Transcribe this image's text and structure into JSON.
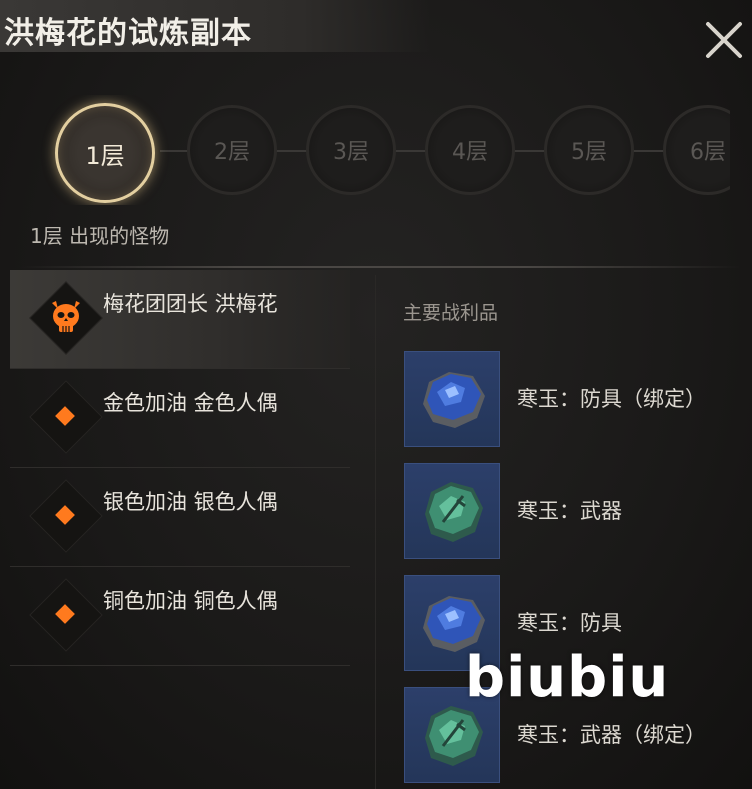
{
  "title": "洪梅花的试炼副本",
  "floors": [
    {
      "label": "1层",
      "active": true
    },
    {
      "label": "2层",
      "active": false
    },
    {
      "label": "3层",
      "active": false
    },
    {
      "label": "4层",
      "active": false
    },
    {
      "label": "5层",
      "active": false
    },
    {
      "label": "6层",
      "active": false
    }
  ],
  "floor_caption": "1层 出现的怪物",
  "monsters": [
    {
      "name": "梅花团团长 洪梅花",
      "icon": "boss-skull-icon",
      "selected": true
    },
    {
      "name": "金色加油 金色人偶",
      "icon": "orange-diamond-icon",
      "selected": false
    },
    {
      "name": "银色加油 银色人偶",
      "icon": "orange-diamond-icon",
      "selected": false
    },
    {
      "name": "铜色加油 铜色人偶",
      "icon": "orange-diamond-icon",
      "selected": false
    }
  ],
  "loot": {
    "title": "主要战利品",
    "items": [
      {
        "name": "寒玉：防具（绑定）",
        "gem": "blue-gem-icon"
      },
      {
        "name": "寒玉：武器",
        "gem": "green-gem-icon"
      },
      {
        "name": "寒玉：防具",
        "gem": "blue-gem-icon"
      },
      {
        "name": "寒玉：武器（绑定）",
        "gem": "green-gem-icon"
      }
    ]
  },
  "watermark": "biubiu",
  "colors": {
    "accent_orange": "#ff7a1e",
    "active_ring": "#e3cfa0",
    "blue_gem": "#2f55b8",
    "green_gem": "#3f8f72",
    "item_frame": "#2c3f6a"
  }
}
